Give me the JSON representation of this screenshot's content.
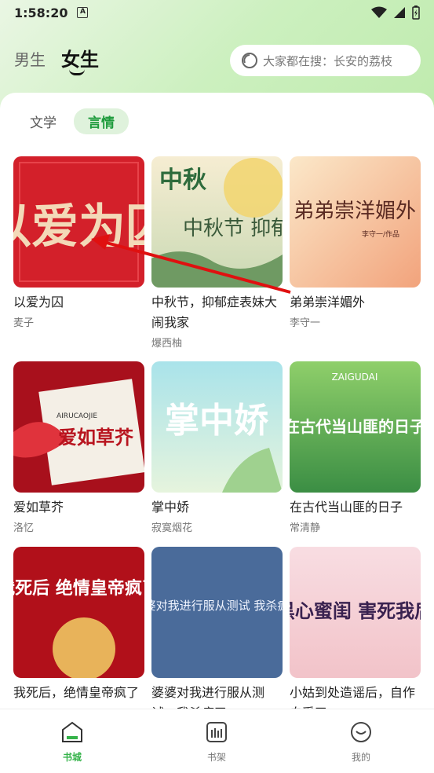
{
  "status_bar": {
    "time": "1:58:20",
    "badge": "A"
  },
  "header": {
    "gender_tabs": [
      {
        "label": "男生"
      },
      {
        "label": "女生"
      }
    ],
    "search_placeholder": "大家都在搜：长安的荔枝"
  },
  "categories": [
    {
      "label": "文学"
    },
    {
      "label": "言情"
    }
  ],
  "books": [
    {
      "title": "以爱为囚",
      "author": "麦子",
      "cover_text": "以爱为囚"
    },
    {
      "title": "中秋节，抑郁症表妹大闹我家",
      "author": "爆西柚",
      "cover_text": "中秋节 抑郁症表妹 大闹我家"
    },
    {
      "title": "弟弟崇洋媚外",
      "author": "李守一",
      "cover_text": "弟弟崇洋媚外",
      "cover_sub": "李守一/作品"
    },
    {
      "title": "爱如草芥",
      "author": "洛忆",
      "cover_text": "爱如草芥",
      "cover_sub": "AIRUCAOJIE"
    },
    {
      "title": "掌中娇",
      "author": "寂寞烟花",
      "cover_text": "掌中娇"
    },
    {
      "title": "在古代当山匪的日子",
      "author": "常清静",
      "cover_text": "在古代当山匪的日子",
      "cover_sub": "ZAIGUDAI"
    },
    {
      "title": "我死后，绝情皇帝疯了",
      "author": "",
      "cover_text": "我死后 绝情皇帝疯了"
    },
    {
      "title": "婆婆对我进行服从测试，我杀疯了",
      "author": "",
      "cover_text": "婆婆对我进行服从测试 我杀疯了"
    },
    {
      "title": "小姑到处造谣后，自作自受了",
      "author": "",
      "cover_text": "黑心蜜闺 害死我后"
    }
  ],
  "bottom_nav": [
    {
      "label": "书城",
      "icon": "bookstore-icon"
    },
    {
      "label": "书架",
      "icon": "bookshelf-icon"
    },
    {
      "label": "我的",
      "icon": "profile-icon"
    }
  ],
  "colors": {
    "accent": "#35b34a",
    "chip_bg": "#dff2dc",
    "annotation_arrow": "#e01010"
  }
}
